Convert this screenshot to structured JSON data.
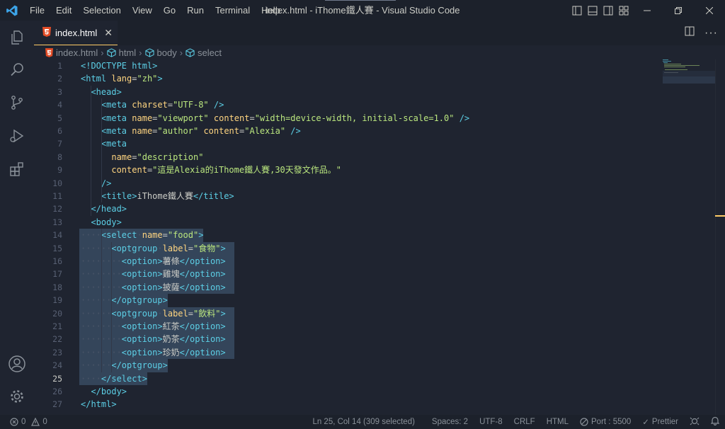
{
  "window": {
    "title": "index.html - iThome鐵人賽 - Visual Studio Code",
    "menu": [
      "File",
      "Edit",
      "Selection",
      "View",
      "Go",
      "Run",
      "Terminal",
      "Help"
    ]
  },
  "activity_bar": [
    "explorer-icon",
    "search-icon",
    "source-control-icon",
    "run-debug-icon",
    "extensions-icon",
    "account-icon",
    "manage-gear-icon"
  ],
  "tab": {
    "label": "index.html",
    "close_label": "✕"
  },
  "breadcrumb": [
    "index.html",
    "html",
    "body",
    "select"
  ],
  "editor": {
    "active_line": 25,
    "lines": [
      {
        "n": "1",
        "html": "<span class=\"t\">&lt;!DOCTYPE html&gt;</span>"
      },
      {
        "n": "2",
        "html": "<span class=\"t\">&lt;html</span> <span class=\"a\">lang</span>=<span class=\"s\">\"zh\"</span><span class=\"t\">&gt;</span>"
      },
      {
        "n": "3",
        "html": "  <span class=\"t\">&lt;head&gt;</span>"
      },
      {
        "n": "4",
        "html": "    <span class=\"t\">&lt;meta</span> <span class=\"a\">charset</span>=<span class=\"s\">\"UTF-8\"</span> <span class=\"t\">/&gt;</span>"
      },
      {
        "n": "5",
        "html": "    <span class=\"t\">&lt;meta</span> <span class=\"a\">name</span>=<span class=\"s\">\"viewport\"</span> <span class=\"a\">content</span>=<span class=\"s\">\"width=device-width, initial-scale=1.0\"</span> <span class=\"t\">/&gt;</span>"
      },
      {
        "n": "6",
        "html": "    <span class=\"t\">&lt;meta</span> <span class=\"a\">name</span>=<span class=\"s\">\"author\"</span> <span class=\"a\">content</span>=<span class=\"s\">\"Alexia\"</span> <span class=\"t\">/&gt;</span>"
      },
      {
        "n": "7",
        "html": "    <span class=\"t\">&lt;meta</span>"
      },
      {
        "n": "8",
        "html": "      <span class=\"a\">name</span>=<span class=\"s\">\"description\"</span>"
      },
      {
        "n": "9",
        "html": "      <span class=\"a\">content</span>=<span class=\"s\">\"這是Alexia的iThome鐵人賽,30天發文作品。\"</span>"
      },
      {
        "n": "10",
        "html": "    <span class=\"t\">/&gt;</span>"
      },
      {
        "n": "11",
        "html": "    <span class=\"t\">&lt;title&gt;</span>iThome鐵人賽<span class=\"t\">&lt;/title&gt;</span>"
      },
      {
        "n": "12",
        "html": "  <span class=\"t\">&lt;/head&gt;</span>"
      },
      {
        "n": "13",
        "html": "  <span class=\"t\">&lt;body&gt;</span>"
      },
      {
        "n": "14",
        "html": "<span class=\"ws\">····</span><span class=\"t\">&lt;select</span><span class=\"ws\">·</span><span class=\"a\">name</span>=<span class=\"s\">\"food\"</span><span class=\"t\">&gt;</span>"
      },
      {
        "n": "15",
        "html": "<span class=\"ws\">······</span><span class=\"t\">&lt;optgroup</span><span class=\"ws\">·</span><span class=\"a\">label</span>=<span class=\"s\">\"食物\"</span><span class=\"t\">&gt;</span>"
      },
      {
        "n": "16",
        "html": "<span class=\"ws\">········</span><span class=\"t\">&lt;option&gt;</span>薯條<span class=\"t\">&lt;/option&gt;</span>"
      },
      {
        "n": "17",
        "html": "<span class=\"ws\">········</span><span class=\"t\">&lt;option&gt;</span>雞塊<span class=\"t\">&lt;/option&gt;</span>"
      },
      {
        "n": "18",
        "html": "<span class=\"ws\">········</span><span class=\"t\">&lt;option&gt;</span>披薩<span class=\"t\">&lt;/option&gt;</span>"
      },
      {
        "n": "19",
        "html": "<span class=\"ws\">······</span><span class=\"t\">&lt;/optgroup&gt;</span>"
      },
      {
        "n": "20",
        "html": "<span class=\"ws\">······</span><span class=\"t\">&lt;optgroup</span><span class=\"ws\">·</span><span class=\"a\">label</span>=<span class=\"s\">\"飲料\"</span><span class=\"t\">&gt;</span>"
      },
      {
        "n": "21",
        "html": "<span class=\"ws\">········</span><span class=\"t\">&lt;option&gt;</span>紅茶<span class=\"t\">&lt;/option&gt;</span>"
      },
      {
        "n": "22",
        "html": "<span class=\"ws\">········</span><span class=\"t\">&lt;option&gt;</span>奶茶<span class=\"t\">&lt;/option&gt;</span>"
      },
      {
        "n": "23",
        "html": "<span class=\"ws\">········</span><span class=\"t\">&lt;option&gt;</span>珍奶<span class=\"t\">&lt;/option&gt;</span>"
      },
      {
        "n": "24",
        "html": "<span class=\"ws\">······</span><span class=\"t\">&lt;/optgroup&gt;</span>"
      },
      {
        "n": "25",
        "html": "<span class=\"ws\">····</span><span class=\"t\">&lt;/select&gt;</span>"
      },
      {
        "n": "26",
        "html": "  <span class=\"t\">&lt;/body&gt;</span>"
      },
      {
        "n": "27",
        "html": "<span class=\"t\">&lt;/html&gt;</span>"
      }
    ]
  },
  "status": {
    "errors": "0",
    "warnings": "0",
    "position": "Ln 25, Col 14 (309 selected)",
    "spaces": "Spaces: 2",
    "encoding": "UTF-8",
    "eol": "CRLF",
    "language": "HTML",
    "port": "Port : 5500",
    "prettier": "Prettier"
  },
  "colors": {
    "background": "#1f2430",
    "titlebar": "#1c212b",
    "accent": "#ffcc66",
    "tag": "#5ccfe6",
    "attribute": "#ffd580",
    "string": "#bae67e",
    "selection": "#34455a"
  }
}
